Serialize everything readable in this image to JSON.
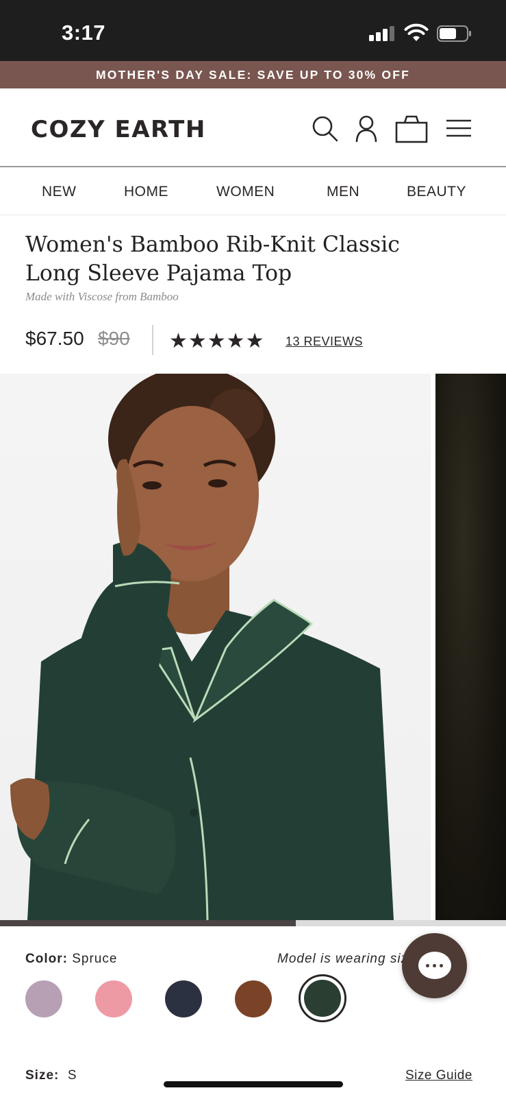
{
  "status_bar": {
    "time": "3:17"
  },
  "promo": {
    "text": "MOTHER'S DAY SALE: SAVE UP TO 30% OFF"
  },
  "header": {
    "logo": "COZY EARTH"
  },
  "nav": {
    "items": [
      "NEW",
      "HOME",
      "WOMEN",
      "MEN",
      "BEAUTY"
    ]
  },
  "product": {
    "title": "Women's Bamboo Rib-Knit Classic Long Sleeve Pajama Top",
    "subtitle": "Made with Viscose from Bamboo",
    "price": "$67.50",
    "original_price": "$90",
    "rating_stars": "★★★★★",
    "rating": 5,
    "reviews": "13 REVIEWS"
  },
  "gallery": {
    "progress": 0.585
  },
  "variants": {
    "color_label": "Color:",
    "color_value": "Spruce",
    "model_note": "Model is wearing size S.",
    "swatches": [
      {
        "name": "lavender",
        "color": "#b7a0b4"
      },
      {
        "name": "pink",
        "color": "#ee9aa4"
      },
      {
        "name": "navy",
        "color": "#2c3141"
      },
      {
        "name": "brown",
        "color": "#7a4327"
      },
      {
        "name": "spruce",
        "color": "#2a3e31",
        "selected": true
      }
    ],
    "size_label": "Size:",
    "size_value": "S",
    "size_guide": "Size Guide"
  },
  "colors": {
    "status_bar_bg": "#1f1e1e",
    "promo_bg": "#7a5650",
    "text": "#2a2626",
    "chat_bg": "#4e3b36"
  }
}
